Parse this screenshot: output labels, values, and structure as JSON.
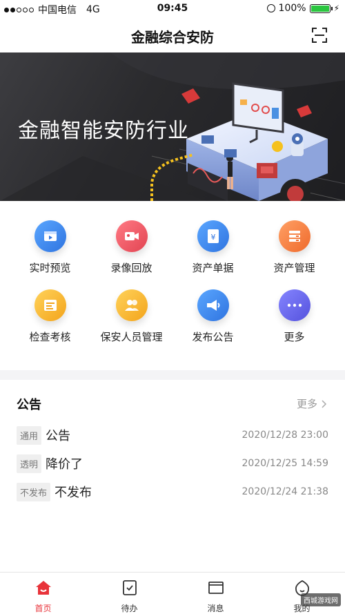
{
  "status_bar": {
    "carrier": "中国电信",
    "network": "4G",
    "time": "09:45",
    "battery": "100%"
  },
  "nav": {
    "title": "金融综合安防"
  },
  "banner": {
    "text": "金融智能安防行业"
  },
  "grid": {
    "items": [
      {
        "label": "实时预览",
        "icon": "video-preview-icon",
        "color": "#3f8cf0"
      },
      {
        "label": "录像回放",
        "icon": "video-camera-icon",
        "color": "#ef5360"
      },
      {
        "label": "资产单据",
        "icon": "yen-document-icon",
        "color": "#3f8cf0"
      },
      {
        "label": "资产管理",
        "icon": "asset-management-icon",
        "color": "#f47a3c"
      },
      {
        "label": "检查考核",
        "icon": "inspection-icon",
        "color": "#f5b92b"
      },
      {
        "label": "保安人员管理",
        "icon": "security-staff-icon",
        "color": "#f5b92b"
      },
      {
        "label": "发布公告",
        "icon": "megaphone-icon",
        "color": "#3f8cf0"
      },
      {
        "label": "更多",
        "icon": "more-icon",
        "color": "#6361e6"
      }
    ]
  },
  "notice": {
    "title": "公告",
    "more": "更多",
    "items": [
      {
        "tag": "通用",
        "text": "公告",
        "time": "2020/12/28 23:00"
      },
      {
        "tag": "透明",
        "text": "降价了",
        "time": "2020/12/25 14:59"
      },
      {
        "tag": "不发布",
        "text": "不发布",
        "time": "2020/12/24 21:38"
      }
    ]
  },
  "tabs": [
    {
      "label": "首页",
      "active": true
    },
    {
      "label": "待办",
      "active": false
    },
    {
      "label": "消息",
      "active": false
    },
    {
      "label": "我的",
      "active": false
    }
  ],
  "watermark": "西城游戏网",
  "colors": {
    "accent": "#e8333a",
    "battery": "#2bc640"
  }
}
